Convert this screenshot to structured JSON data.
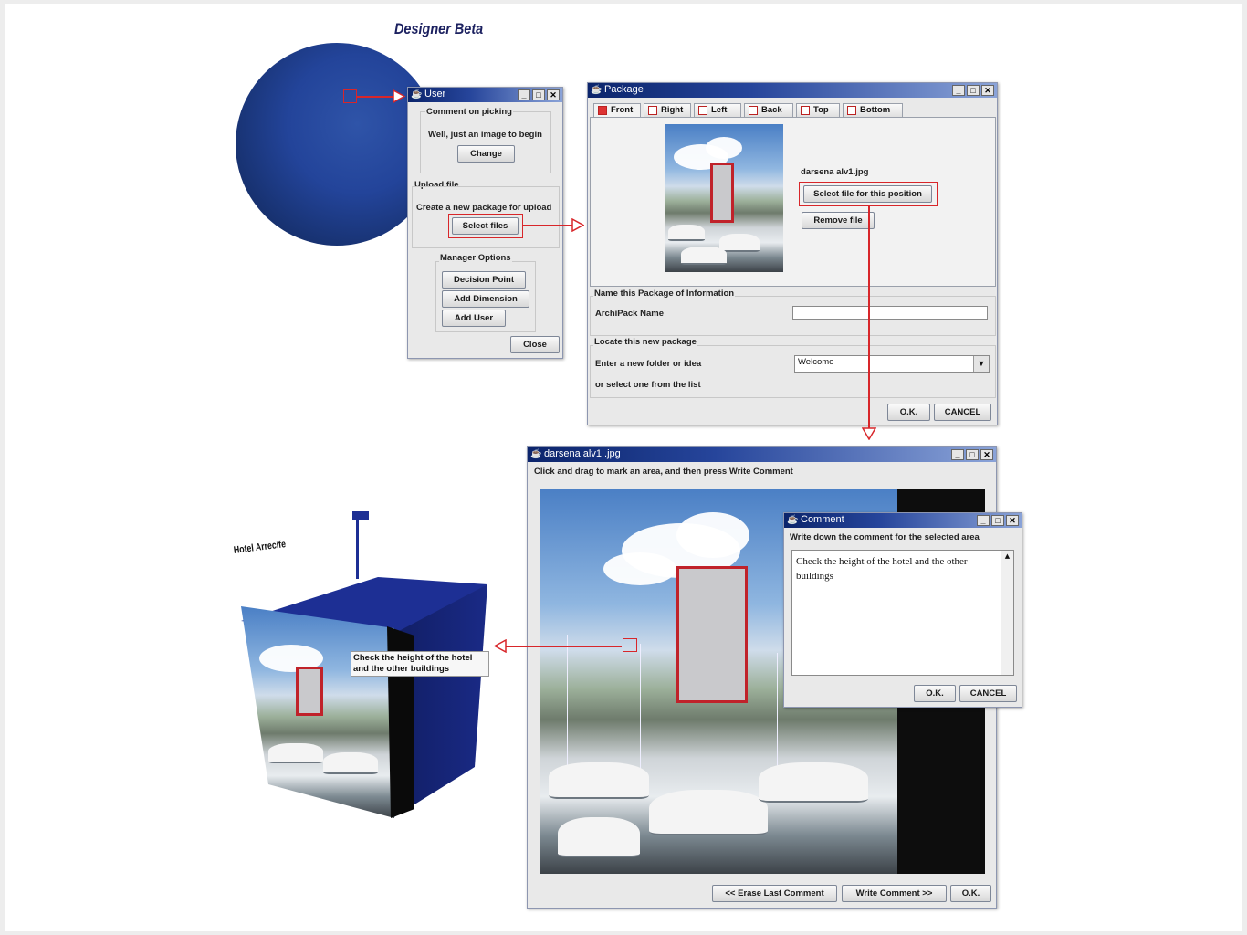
{
  "heading": "Designer Beta",
  "user_window": {
    "title": "User",
    "comment_group": "Comment on picking",
    "comment_text": "Well, just an image to begin",
    "change_button": "Change",
    "upload_group": "Upload file",
    "upload_text": "Create a new package for upload",
    "select_files_button": "Select files",
    "manager_group": "Manager Options",
    "decision_point_button": "Decision Point",
    "add_dimension_button": "Add Dimension",
    "add_user_button": "Add User",
    "close_button": "Close"
  },
  "package_window": {
    "title": "Package",
    "tabs": [
      "Front",
      "Right",
      "Left",
      "Back",
      "Top",
      "Bottom"
    ],
    "active_tab": "Front",
    "file_name": "darsena alv1.jpg",
    "select_file_button": "Select file for this position",
    "remove_file_button": "Remove file",
    "name_group": "Name this Package of Information",
    "archipack_label": "ArchiPack Name",
    "archipack_value": "",
    "locate_group": "Locate this new package",
    "folder_label": "Enter a new folder or idea",
    "folder_value": "Welcome",
    "list_label": "or select one from the list",
    "ok_button": "O.K.",
    "cancel_button": "CANCEL"
  },
  "image_window": {
    "title": "darsena alv1 .jpg",
    "instruction": "Click and drag to mark an area, and then press Write Comment",
    "erase_button": "<< Erase Last Comment",
    "write_button": "Write Comment >>",
    "ok_button": "O.K."
  },
  "comment_window": {
    "title": "Comment",
    "instruction": "Write down the comment for the selected area",
    "comment_text": "Check the height of the hotel and the other buildings",
    "ok_button": "O.K.",
    "cancel_button": "CANCEL"
  },
  "cube": {
    "label": "Hotel Arrecife",
    "tooltip": "Check the height of the hotel and the other buildings"
  },
  "colors": {
    "accent_red": "#d8262a",
    "title_blue": "#0b246b",
    "cube_blue": "#1d2f94"
  }
}
